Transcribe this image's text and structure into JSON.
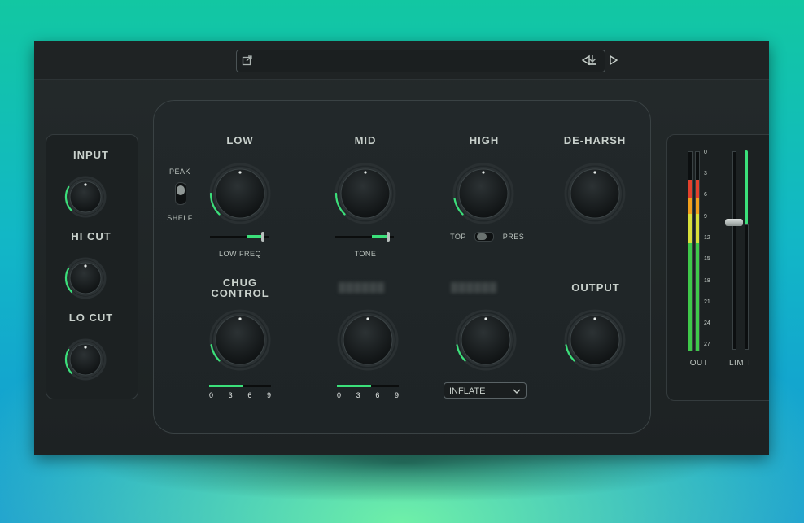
{
  "colors": {
    "accent": "#3be07a",
    "meter_red": "#e2412c",
    "meter_orange": "#f2a01d",
    "meter_yellow": "#d9e03a",
    "meter_green": "#3fc84a"
  },
  "topbar": {
    "preset_name": "",
    "icon_left": "external-link-icon",
    "icon_right": "download-icon",
    "prev_icon": "triangle-left-icon",
    "next_icon": "triangle-right-icon"
  },
  "left_panel": {
    "input_label": "INPUT",
    "hicut_label": "HI CUT",
    "locut_label": "LO CUT"
  },
  "main": {
    "low_label": "LOW",
    "mid_label": "MID",
    "high_label": "HIGH",
    "deharsh_label": "DE-HARSH",
    "peak_label": "PEAK",
    "shelf_label": "SHELF",
    "low_freq_label": "LOW FREQ",
    "tone_label": "TONE",
    "top_label": "TOP",
    "pres_label": "PRES",
    "chug_label_1": "CHUG",
    "chug_label_2": "CONTROL",
    "output_label": "OUTPUT",
    "scale_ticks": [
      "0",
      "3",
      "6",
      "9"
    ],
    "dropdown_value": "INFLATE",
    "low_freq_value": 0.9,
    "tone_value": 0.9,
    "chug_scale_value": 0.55,
    "scale2_value": 0.55
  },
  "right_panel": {
    "out_label": "OUT",
    "limit_label": "LIMIT",
    "meter_ticks": [
      "0",
      "3",
      "6",
      "9",
      "12",
      "15",
      "18",
      "21",
      "24",
      "27"
    ]
  }
}
